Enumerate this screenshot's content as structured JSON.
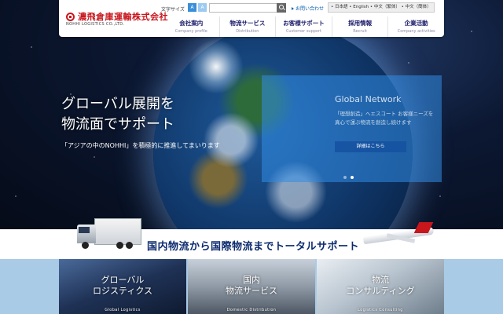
{
  "header": {
    "logo_text": "濃飛倉庫運輸株式会社",
    "logo_sub": "NOHHI LOGISTICS CO.,LTD.",
    "font_size_label": "文字サイズ",
    "font_size_options": [
      "A",
      "A"
    ],
    "contact_label": "お問い合わせ",
    "languages": "• 日本語 • English • 中文（繁体） • 中文（簡体）"
  },
  "nav": [
    {
      "jp": "会社案内",
      "en": "Company profile"
    },
    {
      "jp": "物流サービス",
      "en": "Distribution"
    },
    {
      "jp": "お客様サポート",
      "en": "Customer support"
    },
    {
      "jp": "採用情報",
      "en": "Recruit"
    },
    {
      "jp": "企業活動",
      "en": "Company activities"
    }
  ],
  "hero": {
    "headline_line1": "グローバル展開を",
    "headline_line2": "物流面でサポート",
    "subline": "「アジアの中のNOHHI」を積極的に推進してまいります",
    "panel_title": "Global Network",
    "panel_text": "「理想創造」へエスコート お客様ニーズを真心で運ぶ物流を創造し続けます",
    "panel_button": "詳細はこちら"
  },
  "band": {
    "text": "国内物流から国際物流までトータルサポート"
  },
  "tiles": [
    {
      "title_line1": "グローバル",
      "title_line2": "ロジスティクス",
      "en": "Global Logistics"
    },
    {
      "title_line1": "国内",
      "title_line2": "物流サービス",
      "en": "Domestic Distribution"
    },
    {
      "title_line1": "物流",
      "title_line2": "コンサルティング",
      "en": "Logistics Consulting"
    }
  ],
  "colors": {
    "brand_red": "#c8161d",
    "nav_text": "#1a1a6a",
    "band_text": "#0b2a6e",
    "accent_blue": "#3b8fd8"
  }
}
